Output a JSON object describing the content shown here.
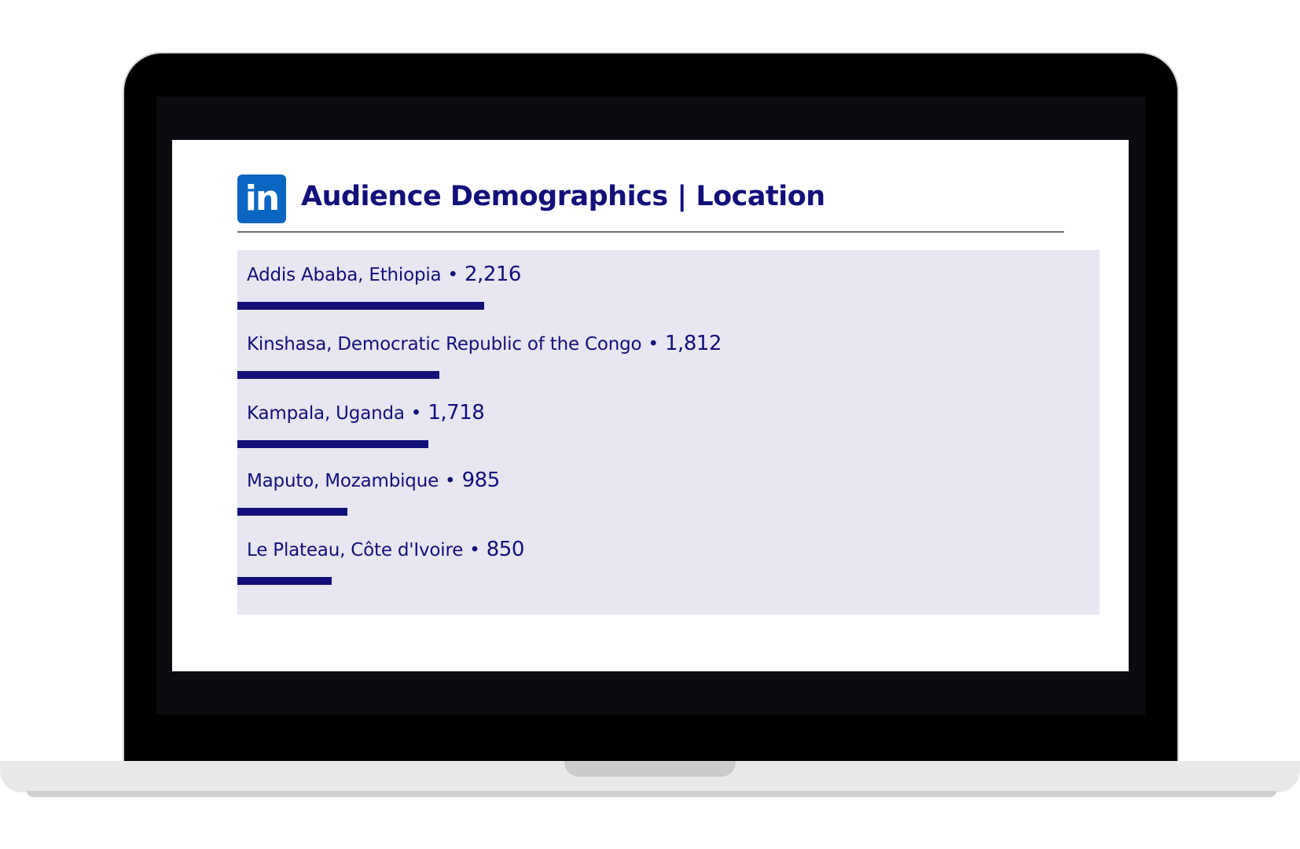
{
  "header": {
    "logo_text": "in",
    "title": "Audience Demographics | Location"
  },
  "separator": "•",
  "locations": [
    {
      "name": "Addis Ababa, Ethiopia",
      "count": "2,216",
      "value": 2216
    },
    {
      "name": "Kinshasa, Democratic Republic of the Congo",
      "count": "1,812",
      "value": 1812
    },
    {
      "name": "Kampala, Uganda",
      "count": "1,718",
      "value": 1718
    },
    {
      "name": "Maputo, Mozambique",
      "count": "985",
      "value": 985
    },
    {
      "name": "Le Plateau, Côte d'Ivoire",
      "count": "850",
      "value": 850
    }
  ],
  "colors": {
    "brand": "#0a66c2",
    "accent": "#13107a",
    "panel": "#e7e6f1"
  }
}
